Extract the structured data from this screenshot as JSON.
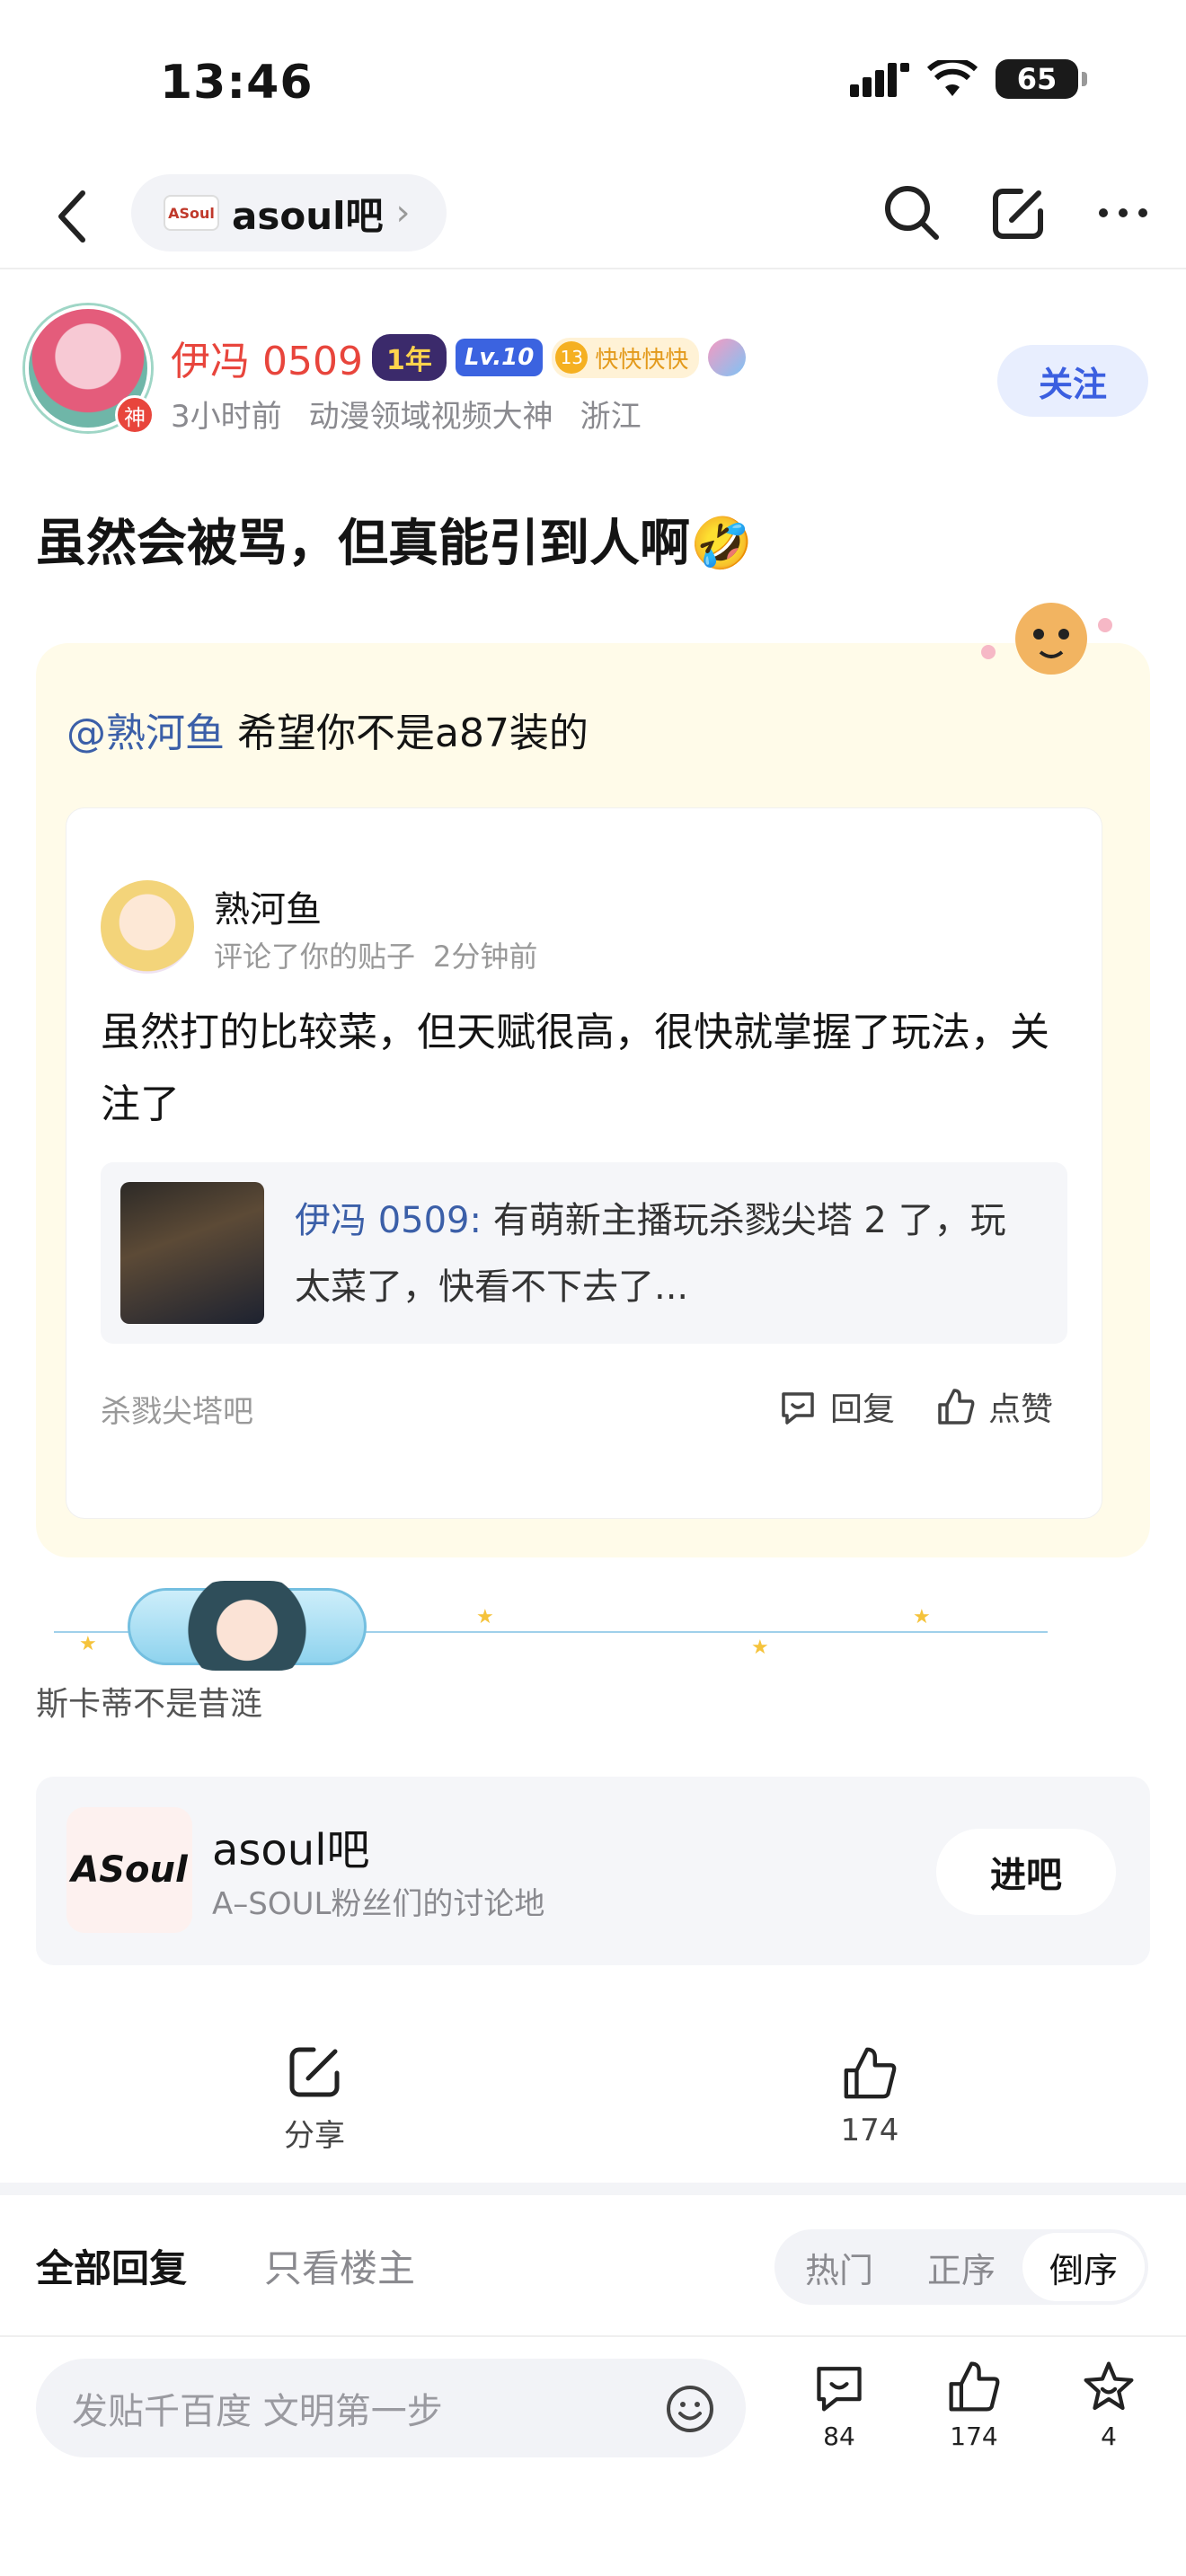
{
  "status_bar": {
    "time": "13:46",
    "battery": "65"
  },
  "nav": {
    "forum_name": "asoul吧",
    "forum_logo_text": "ASoul",
    "chevron": "›"
  },
  "author": {
    "name": "伊冯 0509",
    "god_badge": "神",
    "year_tag": "1年",
    "level_tag": "Lv.10",
    "fan_level": "13",
    "fan_tag": "快快快快",
    "time": "3小时前",
    "title": "动漫领域视频大神",
    "location": "浙江",
    "follow_label": "关注"
  },
  "post": {
    "title": "虽然会被骂，但真能引到人啊🤣",
    "mention": "@熟河鱼",
    "quote_text": " 希望你不是a87装的",
    "reply": {
      "user": "熟河鱼",
      "action": "评论了你的贴子",
      "time": "2分钟前",
      "body": "虽然打的比较菜，但天赋很高，很快就掌握了玩法，关注了",
      "ref_author": "伊冯 0509:",
      "ref_text": " 有萌新主播玩杀戮尖塔 2 了，玩太菜了，快看不下去了...",
      "forum": "杀戮尖塔吧",
      "reply_label": "回复",
      "like_label": "点赞"
    }
  },
  "signature": {
    "text": "斯卡蒂不是昔涟"
  },
  "forum_card": {
    "logo_text": "ASoul",
    "name": "asoul吧",
    "desc": "A–SOUL粉丝们的讨论地",
    "enter_label": "进吧"
  },
  "actions": {
    "share_label": "分享",
    "like_count": "174"
  },
  "reply_tabs": {
    "all": "全部回复",
    "host_only": "只看楼主",
    "sort": [
      "热门",
      "正序",
      "倒序"
    ],
    "active_sort": "倒序"
  },
  "bottom_bar": {
    "placeholder": "发贴千百度 文明第一步",
    "comment_count": "84",
    "like_count": "174",
    "star_count": "4"
  },
  "icons": [
    "back-icon",
    "chevron-right-icon",
    "search-icon",
    "edit-icon",
    "more-icon",
    "comment-icon",
    "thumb-up-icon",
    "share-icon",
    "emoji-icon",
    "star-icon",
    "signal-icon",
    "wifi-icon"
  ],
  "colors": {
    "accent_blue": "#3b5fe0",
    "author_red": "#e8453c",
    "mention_blue": "#3b5fa8",
    "quote_bg": "#fffbe9"
  }
}
